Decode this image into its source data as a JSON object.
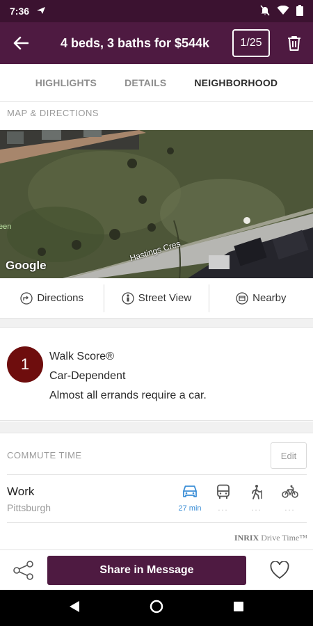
{
  "status_bar": {
    "time": "7:36"
  },
  "header": {
    "title": "4 beds, 3 baths for $544k",
    "counter": "1/25"
  },
  "tabs": [
    {
      "label": "HIGHLIGHTS",
      "active": false
    },
    {
      "label": "DETAILS",
      "active": false
    },
    {
      "label": "NEIGHBORHOOD",
      "active": true
    }
  ],
  "map": {
    "section_label": "MAP & DIRECTIONS",
    "attribution": "Google",
    "street_label": "Hastings Cres",
    "edge_label": "een"
  },
  "map_actions": {
    "directions": "Directions",
    "street_view": "Street View",
    "nearby": "Nearby"
  },
  "walk_score": {
    "score": "1",
    "title": "Walk Score®",
    "category": "Car-Dependent",
    "description": "Almost all errands require a car."
  },
  "commute": {
    "section_label": "COMMUTE TIME",
    "edit_label": "Edit",
    "destination": "Work",
    "location": "Pittsburgh",
    "modes": [
      {
        "icon": "car-icon",
        "time": "27 min",
        "active": true
      },
      {
        "icon": "bus-icon",
        "time": "...",
        "active": false
      },
      {
        "icon": "walk-icon",
        "time": "...",
        "active": false
      },
      {
        "icon": "bike-icon",
        "time": "...",
        "active": false
      }
    ],
    "provider_brand": "INRIX",
    "provider_product": "Drive Time™"
  },
  "bottom_bar": {
    "share_label": "Share in Message"
  },
  "colors": {
    "primary": "#4e1a41",
    "status_bar": "#3b1230",
    "walk_badge": "#6e0d0d",
    "active_mode": "#3b8ed6"
  }
}
